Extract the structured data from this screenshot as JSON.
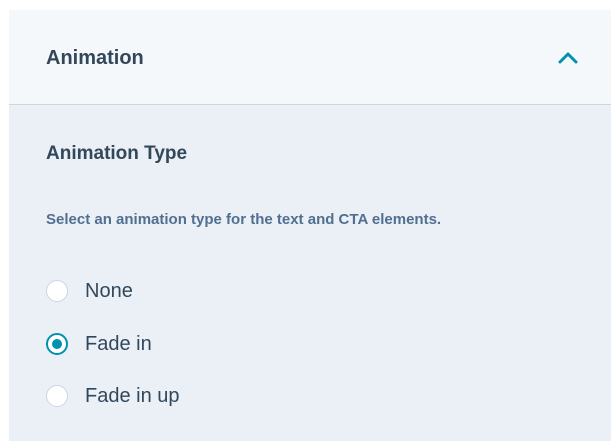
{
  "panel": {
    "title": "Animation",
    "expanded": true,
    "chevron_icon": "chevron-up-icon"
  },
  "section": {
    "title": "Animation Type",
    "help_text": "Select an animation type for the text and CTA elements."
  },
  "animation_options": [
    {
      "label": "None",
      "selected": false
    },
    {
      "label": "Fade in",
      "selected": true
    },
    {
      "label": "Fade in up",
      "selected": false
    }
  ],
  "colors": {
    "accent": "#0091ae",
    "heading_text": "#33475b",
    "help_text": "#516f90",
    "header_bg": "#f5f8fa",
    "body_bg": "#eaf0f6",
    "divider": "#cbd6e2"
  }
}
